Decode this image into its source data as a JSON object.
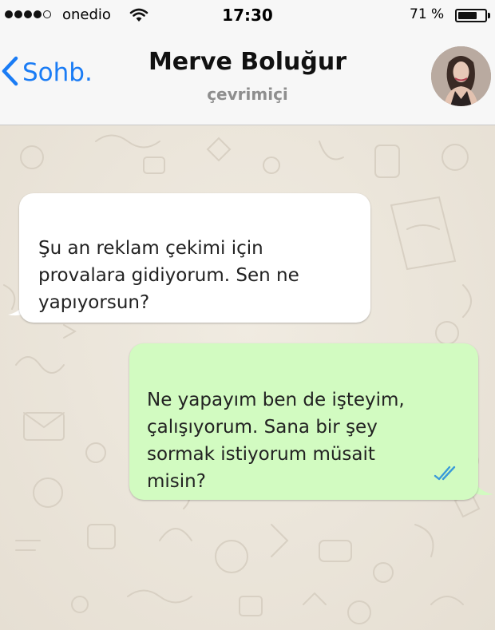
{
  "status_bar": {
    "carrier": "onedio",
    "time": "17:30",
    "battery_percent": "71 %",
    "battery_level": 0.71,
    "signal_bars_filled": 4,
    "signal_bars_total": 5,
    "icons": [
      "signal-dots-icon",
      "wifi-icon",
      "battery-icon"
    ]
  },
  "header": {
    "back_label": "Sohb.",
    "back_icon": "chevron-left-icon",
    "contact_name": "Merve Boluğur",
    "contact_status": "çevrimiçi",
    "avatar": "contact-avatar"
  },
  "messages": [
    {
      "direction": "incoming",
      "text": "Şu an reklam çekimi için\nprovalara gidiyorum. Sen ne\nyapıyorsun?"
    },
    {
      "direction": "outgoing",
      "text": "Ne yapayım ben de işteyim,\nçalışıyorum. Sana bir şey\nsormak istiyorum müsait\nmisin?",
      "receipt_icon": "double-check-icon",
      "read": true
    }
  ],
  "colors": {
    "accent": "#1a7cf5",
    "incoming_bubble": "#ffffff",
    "outgoing_bubble": "#d2fbc1",
    "read_tick": "#3a9ad9",
    "chat_background": "#e9e3d8"
  }
}
